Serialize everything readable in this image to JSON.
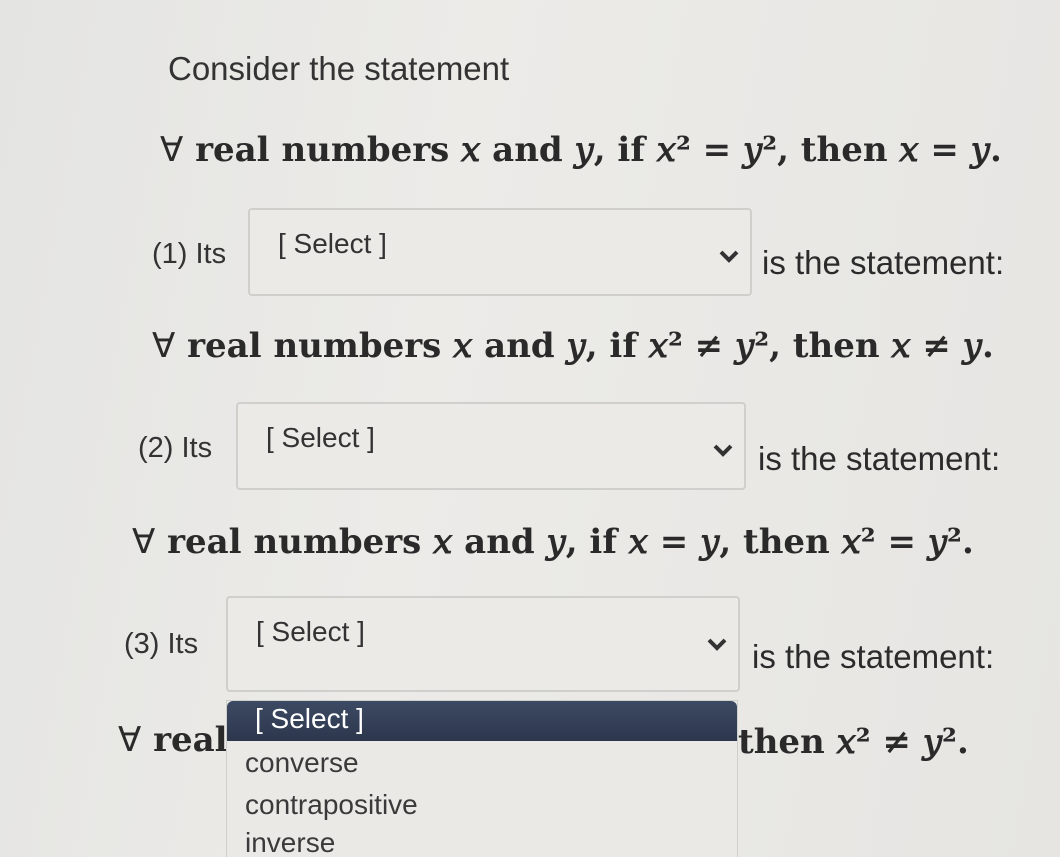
{
  "intro": "Consider the statement",
  "original": {
    "forall": "∀",
    "text": "real numbers 𝑥 and 𝑦, if 𝑥² = 𝑦², then 𝑥 = 𝑦."
  },
  "questions": [
    {
      "label": "(1) Its",
      "selected": "[ Select ]",
      "after": "is the statement:",
      "forall": "∀",
      "statement": "real numbers 𝑥 and 𝑦, if 𝑥² ≠ 𝑦², then 𝑥 ≠ 𝑦."
    },
    {
      "label": "(2) Its",
      "selected": "[ Select ]",
      "after": "is the statement:",
      "forall": "∀",
      "statement": "real numbers 𝑥 and 𝑦, if 𝑥 = 𝑦, then 𝑥² = 𝑦²."
    },
    {
      "label": "(3) Its",
      "selected": "[ Select ]",
      "after": "is the statement:",
      "forall": "∀",
      "statement_start": "real",
      "statement_end": "then 𝑥² ≠ 𝑦²."
    }
  ],
  "dropdown": {
    "options": [
      "[ Select ]",
      "converse",
      "contrapositive",
      "inverse"
    ],
    "highlighted_index": 0
  },
  "colors": {
    "dropdown_highlight": "#2f3a50",
    "select_bg": "#ebeae7"
  }
}
